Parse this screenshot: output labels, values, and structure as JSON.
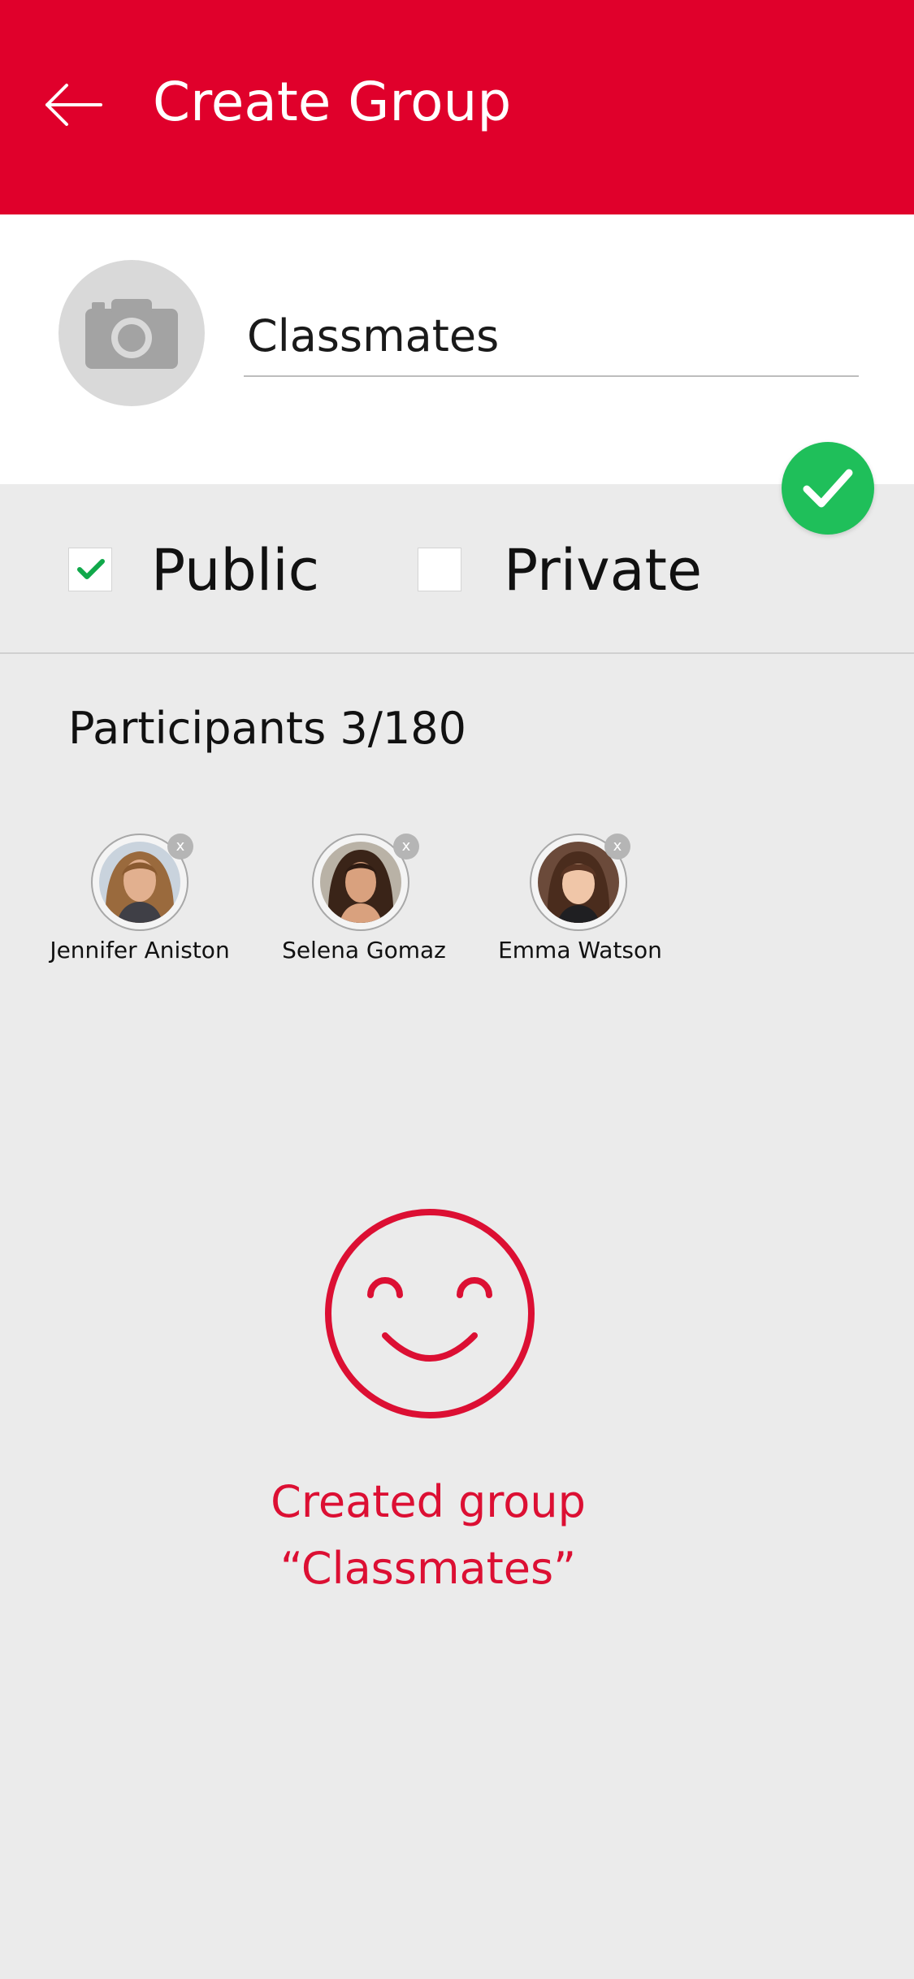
{
  "header": {
    "title": "Create Group"
  },
  "group": {
    "name": "Classmates"
  },
  "visibility": {
    "public_label": "Public",
    "private_label": "Private",
    "public_checked": true,
    "private_checked": false
  },
  "participants": {
    "title": "Participants 3/180",
    "remove_label": "x",
    "items": [
      {
        "name": "Jennifer Aniston"
      },
      {
        "name": "Selena Gomaz"
      },
      {
        "name": "Emma Watson"
      }
    ]
  },
  "success": {
    "line1": "Created group",
    "line2": "“Classmates”"
  },
  "colors": {
    "brand_red": "#e0002b",
    "success_green": "#1fbf5a",
    "background": "#ebebeb"
  }
}
